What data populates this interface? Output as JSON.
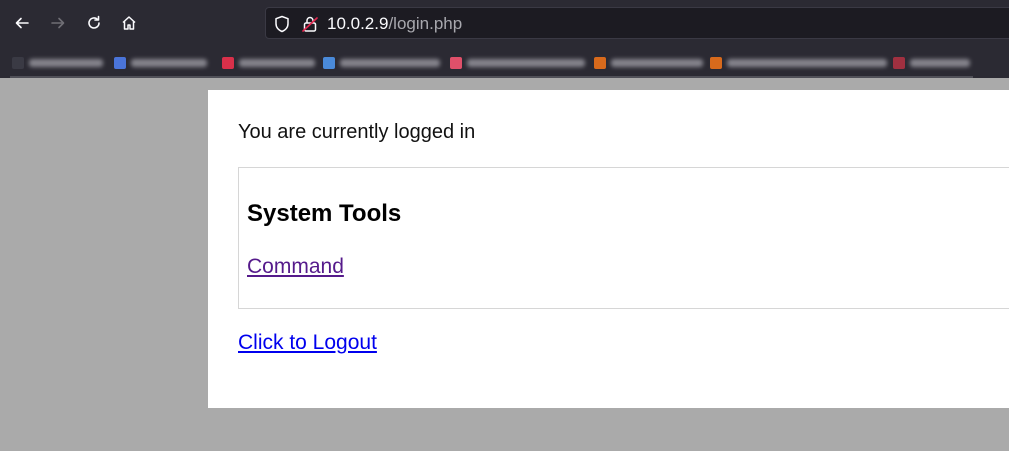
{
  "browser": {
    "url": {
      "host": "10.0.2.9",
      "path": "/login.php"
    },
    "icons": [
      "back-icon",
      "forward-icon",
      "reload-icon",
      "home-icon",
      "shield-icon",
      "lock-icon"
    ],
    "bookmarks_count": 8,
    "colors": {
      "toolbar": "#2b2a33",
      "urlbar": "#1c1b22",
      "url_text": "#fbfbfe"
    }
  },
  "page": {
    "status_text": "You are currently logged in",
    "tools_title": "System Tools",
    "command_label": "Command",
    "logout_label": "Click to Logout",
    "colors": {
      "background": "#aaaaaa",
      "card": "#ffffff",
      "visited_link": "#551a8b",
      "link": "#0000ee"
    }
  }
}
